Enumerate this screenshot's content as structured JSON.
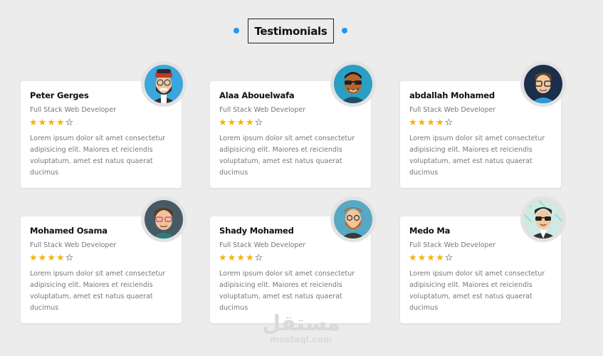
{
  "section": {
    "title": "Testimonials",
    "accent_color": "#2196f3",
    "star_color": "#f5b400"
  },
  "testimonials": [
    {
      "name": "Peter Gerges",
      "role": "Full Stack Web Developer",
      "rating": 4,
      "max_rating": 5,
      "text": "Lorem ipsum dolor sit amet consectetur adipisicing elit. Maiores et reiciendis voluptatum, amet est natus quaerat ducimus",
      "avatar": "avatar-bearded-cap"
    },
    {
      "name": "Alaa Abouelwafa",
      "role": "Full Stack Web Developer",
      "rating": 4,
      "max_rating": 5,
      "text": "Lorem ipsum dolor sit amet consectetur adipisicing elit. Maiores et reiciendis voluptatum, amet est natus quaerat ducimus",
      "avatar": "avatar-sunglasses"
    },
    {
      "name": "abdallah Mohamed",
      "role": "Full Stack Web Developer",
      "rating": 4,
      "max_rating": 5,
      "text": "Lorem ipsum dolor sit amet consectetur adipisicing elit. Maiores et reiciendis voluptatum, amet est natus quaerat ducimus",
      "avatar": "avatar-glasses"
    },
    {
      "name": "Mohamed Osama",
      "role": "Full Stack Web Developer",
      "rating": 4,
      "max_rating": 5,
      "text": "Lorem ipsum dolor sit amet consectetur adipisicing elit. Maiores et reiciendis voluptatum, amet est natus quaerat ducimus",
      "avatar": "avatar-pink-glasses"
    },
    {
      "name": "Shady Mohamed",
      "role": "Full Stack Web Developer",
      "rating": 4,
      "max_rating": 5,
      "text": "Lorem ipsum dolor sit amet consectetur adipisicing elit. Maiores et reiciendis voluptatum, amet est natus quaerat ducimus",
      "avatar": "avatar-beard"
    },
    {
      "name": "Medo Ma",
      "role": "Full Stack Web Developer",
      "rating": 4,
      "max_rating": 5,
      "text": "Lorem ipsum dolor sit amet consectetur adipisicing elit. Maiores et reiciendis voluptatum, amet est natus quaerat ducimus",
      "avatar": "avatar-suit-sunglasses"
    }
  ],
  "watermark": {
    "arabic": "مستقل",
    "latin": "mostaql.com"
  }
}
